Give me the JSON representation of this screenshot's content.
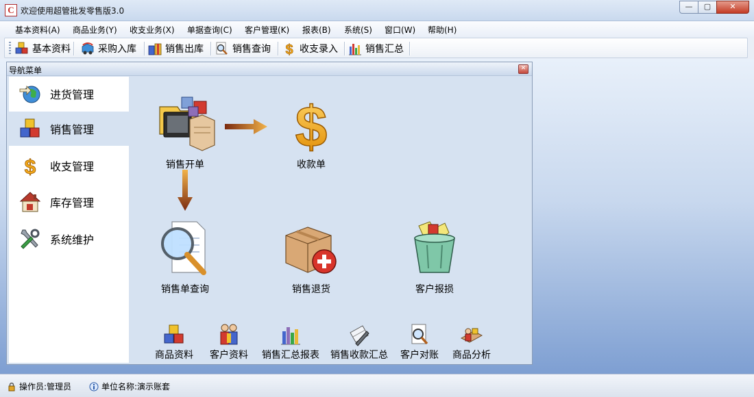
{
  "window": {
    "title": "欢迎使用超管批发零售版3.0",
    "app_icon_letter": "C"
  },
  "menu": [
    {
      "label": "基本资料(A)"
    },
    {
      "label": "商品业务(Y)"
    },
    {
      "label": "收支业务(X)"
    },
    {
      "label": "单据查询(C)"
    },
    {
      "label": "客户管理(K)"
    },
    {
      "label": "报表(B)"
    },
    {
      "label": "系统(S)"
    },
    {
      "label": "窗口(W)"
    },
    {
      "label": "帮助(H)"
    }
  ],
  "toolbar": [
    {
      "label": "基本资料",
      "icon": "cubes-icon"
    },
    {
      "label": "采购入库",
      "icon": "car-icon"
    },
    {
      "label": "销售出库",
      "icon": "gift-icon"
    },
    {
      "label": "销售查询",
      "icon": "magnifier-icon"
    },
    {
      "label": "收支录入",
      "icon": "dollar-icon"
    },
    {
      "label": "销售汇总",
      "icon": "bar-chart-icon"
    }
  ],
  "nav": {
    "title": "导航菜单",
    "sidebar": [
      {
        "label": "进货管理",
        "icon": "globe-icon"
      },
      {
        "label": "销售管理",
        "icon": "cubes-icon",
        "active": true
      },
      {
        "label": "收支管理",
        "icon": "dollar-icon"
      },
      {
        "label": "库存管理",
        "icon": "house-icon"
      },
      {
        "label": "系统维护",
        "icon": "tools-icon"
      }
    ],
    "flow": [
      {
        "label": "销售开单",
        "icon": "computer-icon"
      },
      {
        "label": "收款单",
        "icon": "dollar-icon"
      },
      {
        "label": "销售单查询",
        "icon": "search-document-icon"
      },
      {
        "label": "销售退货",
        "icon": "box-return-icon"
      },
      {
        "label": "客户报损",
        "icon": "trash-icon"
      }
    ],
    "shortcuts": [
      {
        "label": "商品资料",
        "icon": "cubes-icon"
      },
      {
        "label": "客户资料",
        "icon": "people-icon"
      },
      {
        "label": "销售汇总报表",
        "icon": "bar-chart-icon"
      },
      {
        "label": "销售收款汇总",
        "icon": "pen-icon"
      },
      {
        "label": "客户对账",
        "icon": "magnifier-icon"
      },
      {
        "label": "商品分析",
        "icon": "analysis-icon"
      }
    ]
  },
  "status": {
    "operator": "操作员:管理员",
    "company": "单位名称:演示账套"
  },
  "colors": {
    "accent": "#c8312b",
    "panel": "#d6e2f1",
    "desktop_bottom": "#7e9fd2"
  }
}
